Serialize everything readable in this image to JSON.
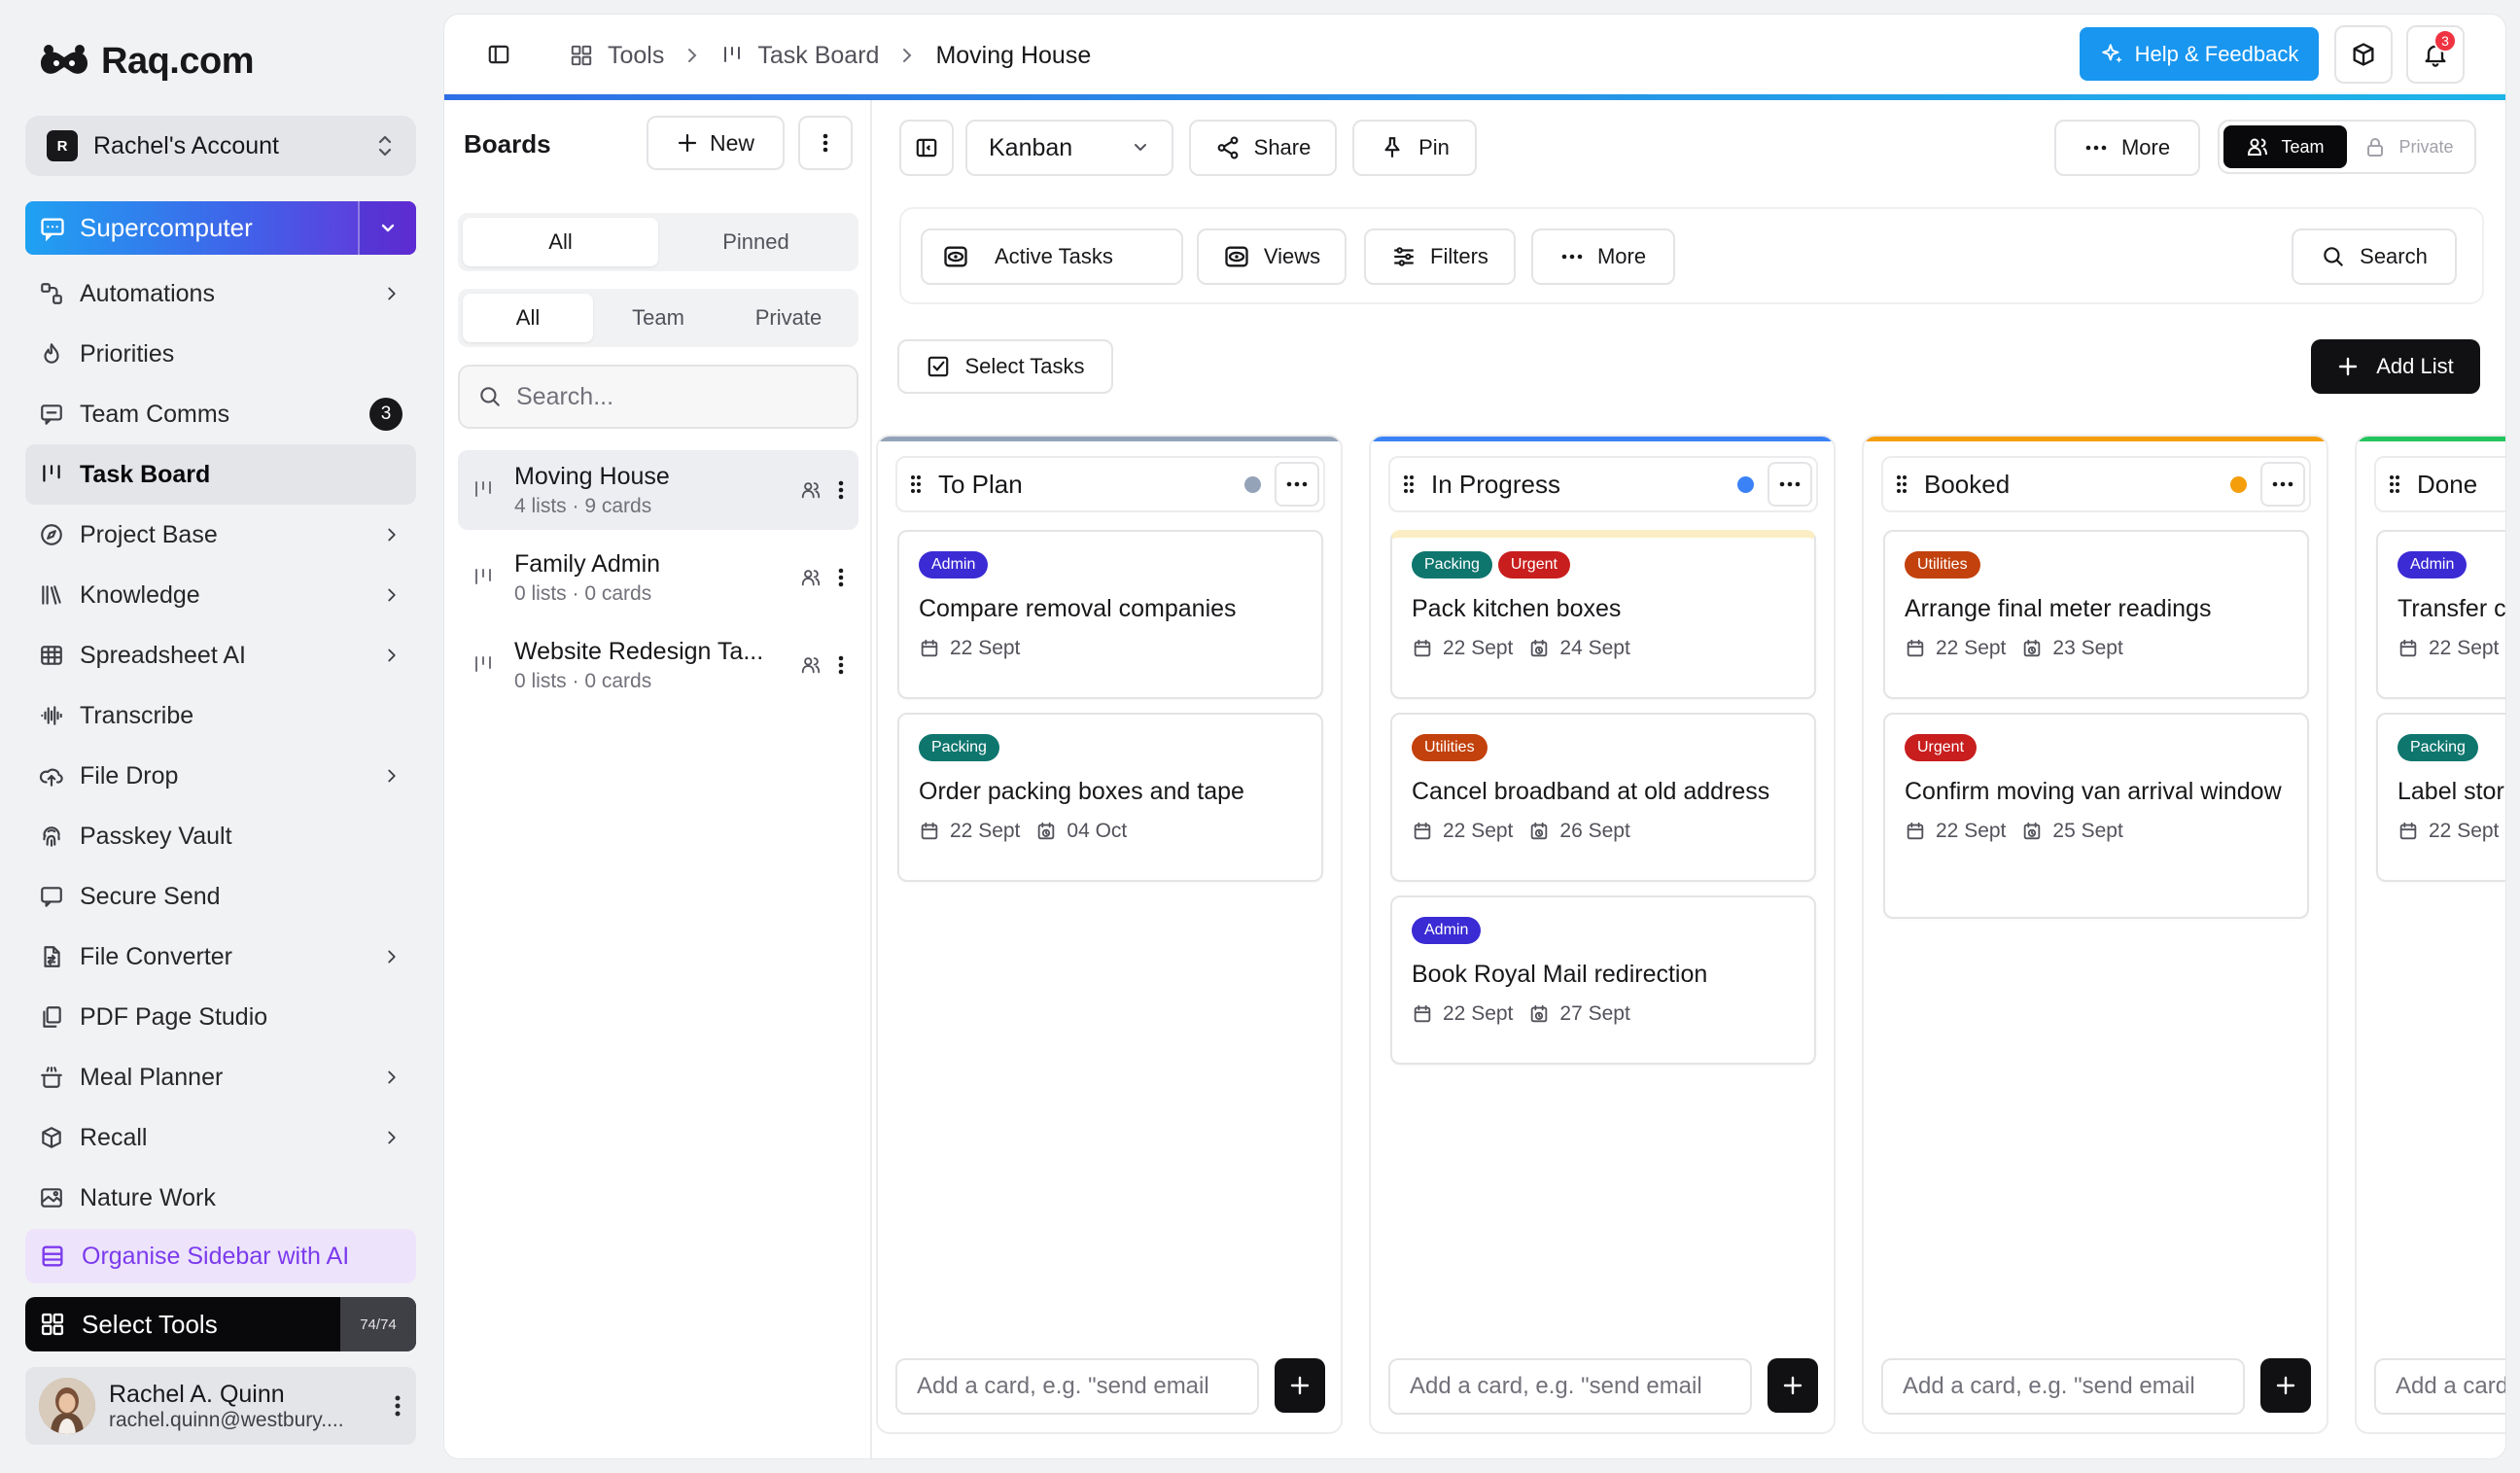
{
  "app": {
    "brand": "Raq.com"
  },
  "sidebar": {
    "account": {
      "initial": "R",
      "name": "Rachel's Account"
    },
    "supercomputer": "Supercomputer",
    "items": [
      {
        "label": "Automations",
        "icon": "automations-icon",
        "chevron": true
      },
      {
        "label": "Priorities",
        "icon": "flame-icon",
        "chevron": false
      },
      {
        "label": "Team Comms",
        "icon": "chat-icon",
        "chevron": false,
        "badge": "3"
      },
      {
        "label": "Task Board",
        "icon": "kanban-icon",
        "chevron": false,
        "active": true
      },
      {
        "label": "Project Base",
        "icon": "compass-icon",
        "chevron": true
      },
      {
        "label": "Knowledge",
        "icon": "library-icon",
        "chevron": true
      },
      {
        "label": "Spreadsheet AI",
        "icon": "table-icon",
        "chevron": true
      },
      {
        "label": "Transcribe",
        "icon": "waveform-icon",
        "chevron": false
      },
      {
        "label": "File Drop",
        "icon": "upload-cloud-icon",
        "chevron": true
      },
      {
        "label": "Passkey Vault",
        "icon": "fingerprint-icon",
        "chevron": false
      },
      {
        "label": "Secure Send",
        "icon": "chat-lock-icon",
        "chevron": false
      },
      {
        "label": "File Converter",
        "icon": "file-convert-icon",
        "chevron": true
      },
      {
        "label": "PDF Page Studio",
        "icon": "pages-icon",
        "chevron": false
      },
      {
        "label": "Meal Planner",
        "icon": "cooking-pot-icon",
        "chevron": true
      },
      {
        "label": "Recall",
        "icon": "box-icon",
        "chevron": true
      },
      {
        "label": "Nature Work",
        "icon": "image-leaf-icon",
        "chevron": false
      }
    ],
    "organise": "Organise Sidebar with AI",
    "select_tools": {
      "label": "Select Tools",
      "count": "74/74"
    },
    "user": {
      "name": "Rachel A. Quinn",
      "email": "rachel.quinn@westbury...."
    }
  },
  "topbar": {
    "crumbs": [
      "Tools",
      "Task Board",
      "Moving House"
    ],
    "help": "Help & Feedback",
    "notifications": "3"
  },
  "boards": {
    "title": "Boards",
    "new_label": "New",
    "filter1": [
      "All",
      "Pinned"
    ],
    "filter2": [
      "All",
      "Team",
      "Private"
    ],
    "search_placeholder": "Search...",
    "list": [
      {
        "name": "Moving House",
        "sub": "4 lists · 9 cards",
        "active": true
      },
      {
        "name": "Family Admin",
        "sub": "0 lists · 0 cards",
        "active": false
      },
      {
        "name": "Website Redesign Ta...",
        "sub": "0 lists · 0 cards",
        "active": false
      }
    ]
  },
  "toolbar": {
    "view": "Kanban",
    "share": "Share",
    "pin": "Pin",
    "more": "More",
    "team": "Team",
    "private": "Private"
  },
  "filters": {
    "active_tasks": "Active Tasks",
    "views": "Views",
    "filters": "Filters",
    "more": "More",
    "search": "Search",
    "select_tasks": "Select Tasks",
    "add_list": "Add List"
  },
  "tag_colors": {
    "Admin": "#3b2bd4",
    "Packing": "#0f766e",
    "Urgent": "#c81e1e",
    "Utilities": "#c2410c"
  },
  "columns": [
    {
      "title": "To Plan",
      "color": "#94a3b8",
      "dot": "#94a3b8",
      "placeholder": "Add a card, e.g. \"send email",
      "cards": [
        {
          "tags": [
            "Admin"
          ],
          "title": "Compare removal companies",
          "start": "22 Sept",
          "due": ""
        },
        {
          "tags": [
            "Packing"
          ],
          "title": "Order packing boxes and tape",
          "start": "22 Sept",
          "due": "04 Oct"
        }
      ]
    },
    {
      "title": "In Progress",
      "color": "#3b82f6",
      "dot": "#3b82f6",
      "placeholder": "Add a card, e.g. \"send email",
      "cards": [
        {
          "tags": [
            "Packing",
            "Urgent"
          ],
          "title": "Pack kitchen boxes",
          "start": "22 Sept",
          "due": "24 Sept",
          "highlight": true
        },
        {
          "tags": [
            "Utilities"
          ],
          "title": "Cancel broadband at old address",
          "start": "22 Sept",
          "due": "26 Sept"
        },
        {
          "tags": [
            "Admin"
          ],
          "title": "Book Royal Mail redirection",
          "start": "22 Sept",
          "due": "27 Sept"
        }
      ]
    },
    {
      "title": "Booked",
      "color": "#f59e0b",
      "dot": "#f59e0b",
      "placeholder": "Add a card, e.g. \"send email",
      "cards": [
        {
          "tags": [
            "Utilities"
          ],
          "title": "Arrange final meter readings",
          "start": "22 Sept",
          "due": "23 Sept"
        },
        {
          "tags": [
            "Urgent"
          ],
          "title": "Confirm moving van arrival window",
          "start": "22 Sept",
          "due": "25 Sept"
        }
      ]
    },
    {
      "title": "Done",
      "color": "#22c55e",
      "dot": "#22c55e",
      "placeholder": "Add a card, e.g. \"send email",
      "cards": [
        {
          "tags": [
            "Admin"
          ],
          "title": "Transfer c",
          "start": "22 Sept",
          "due": ""
        },
        {
          "tags": [
            "Packing"
          ],
          "title": "Label stor",
          "start": "22 Sept",
          "due": ""
        }
      ]
    }
  ]
}
